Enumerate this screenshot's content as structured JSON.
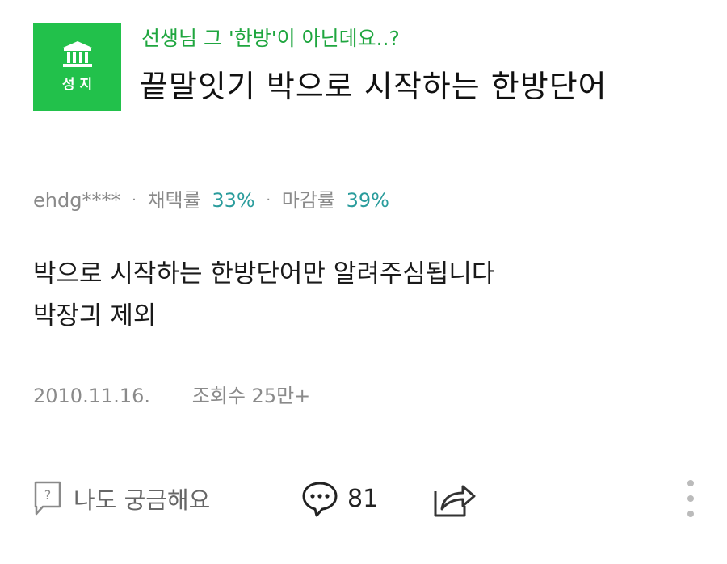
{
  "question": {
    "badge_label": "성지",
    "topic": "선생님 그 '한방'이 아닌데요..?",
    "title": "끝말잇기 박으로 시작하는 한방단어"
  },
  "meta": {
    "user": "ehdg****",
    "adopt_label": "채택률",
    "adopt_rate": "33%",
    "close_label": "마감률",
    "close_rate": "39%"
  },
  "body": {
    "lines": [
      "박으로 시작하는 한방단어만 알려주심됩니다",
      "박장긔 제외"
    ]
  },
  "info": {
    "date": "2010.11.16.",
    "views": "조회수 25만+"
  },
  "actions": {
    "curious_label": "나도 궁금해요",
    "comment_count": "81"
  },
  "colors": {
    "badge_green": "#22c14b",
    "topic_green": "#1fa63f",
    "rate_teal": "#2a9c9c"
  },
  "icons": [
    "building-icon",
    "question-box-icon",
    "speech-bubble-icon",
    "share-icon",
    "more-vertical-icon"
  ]
}
